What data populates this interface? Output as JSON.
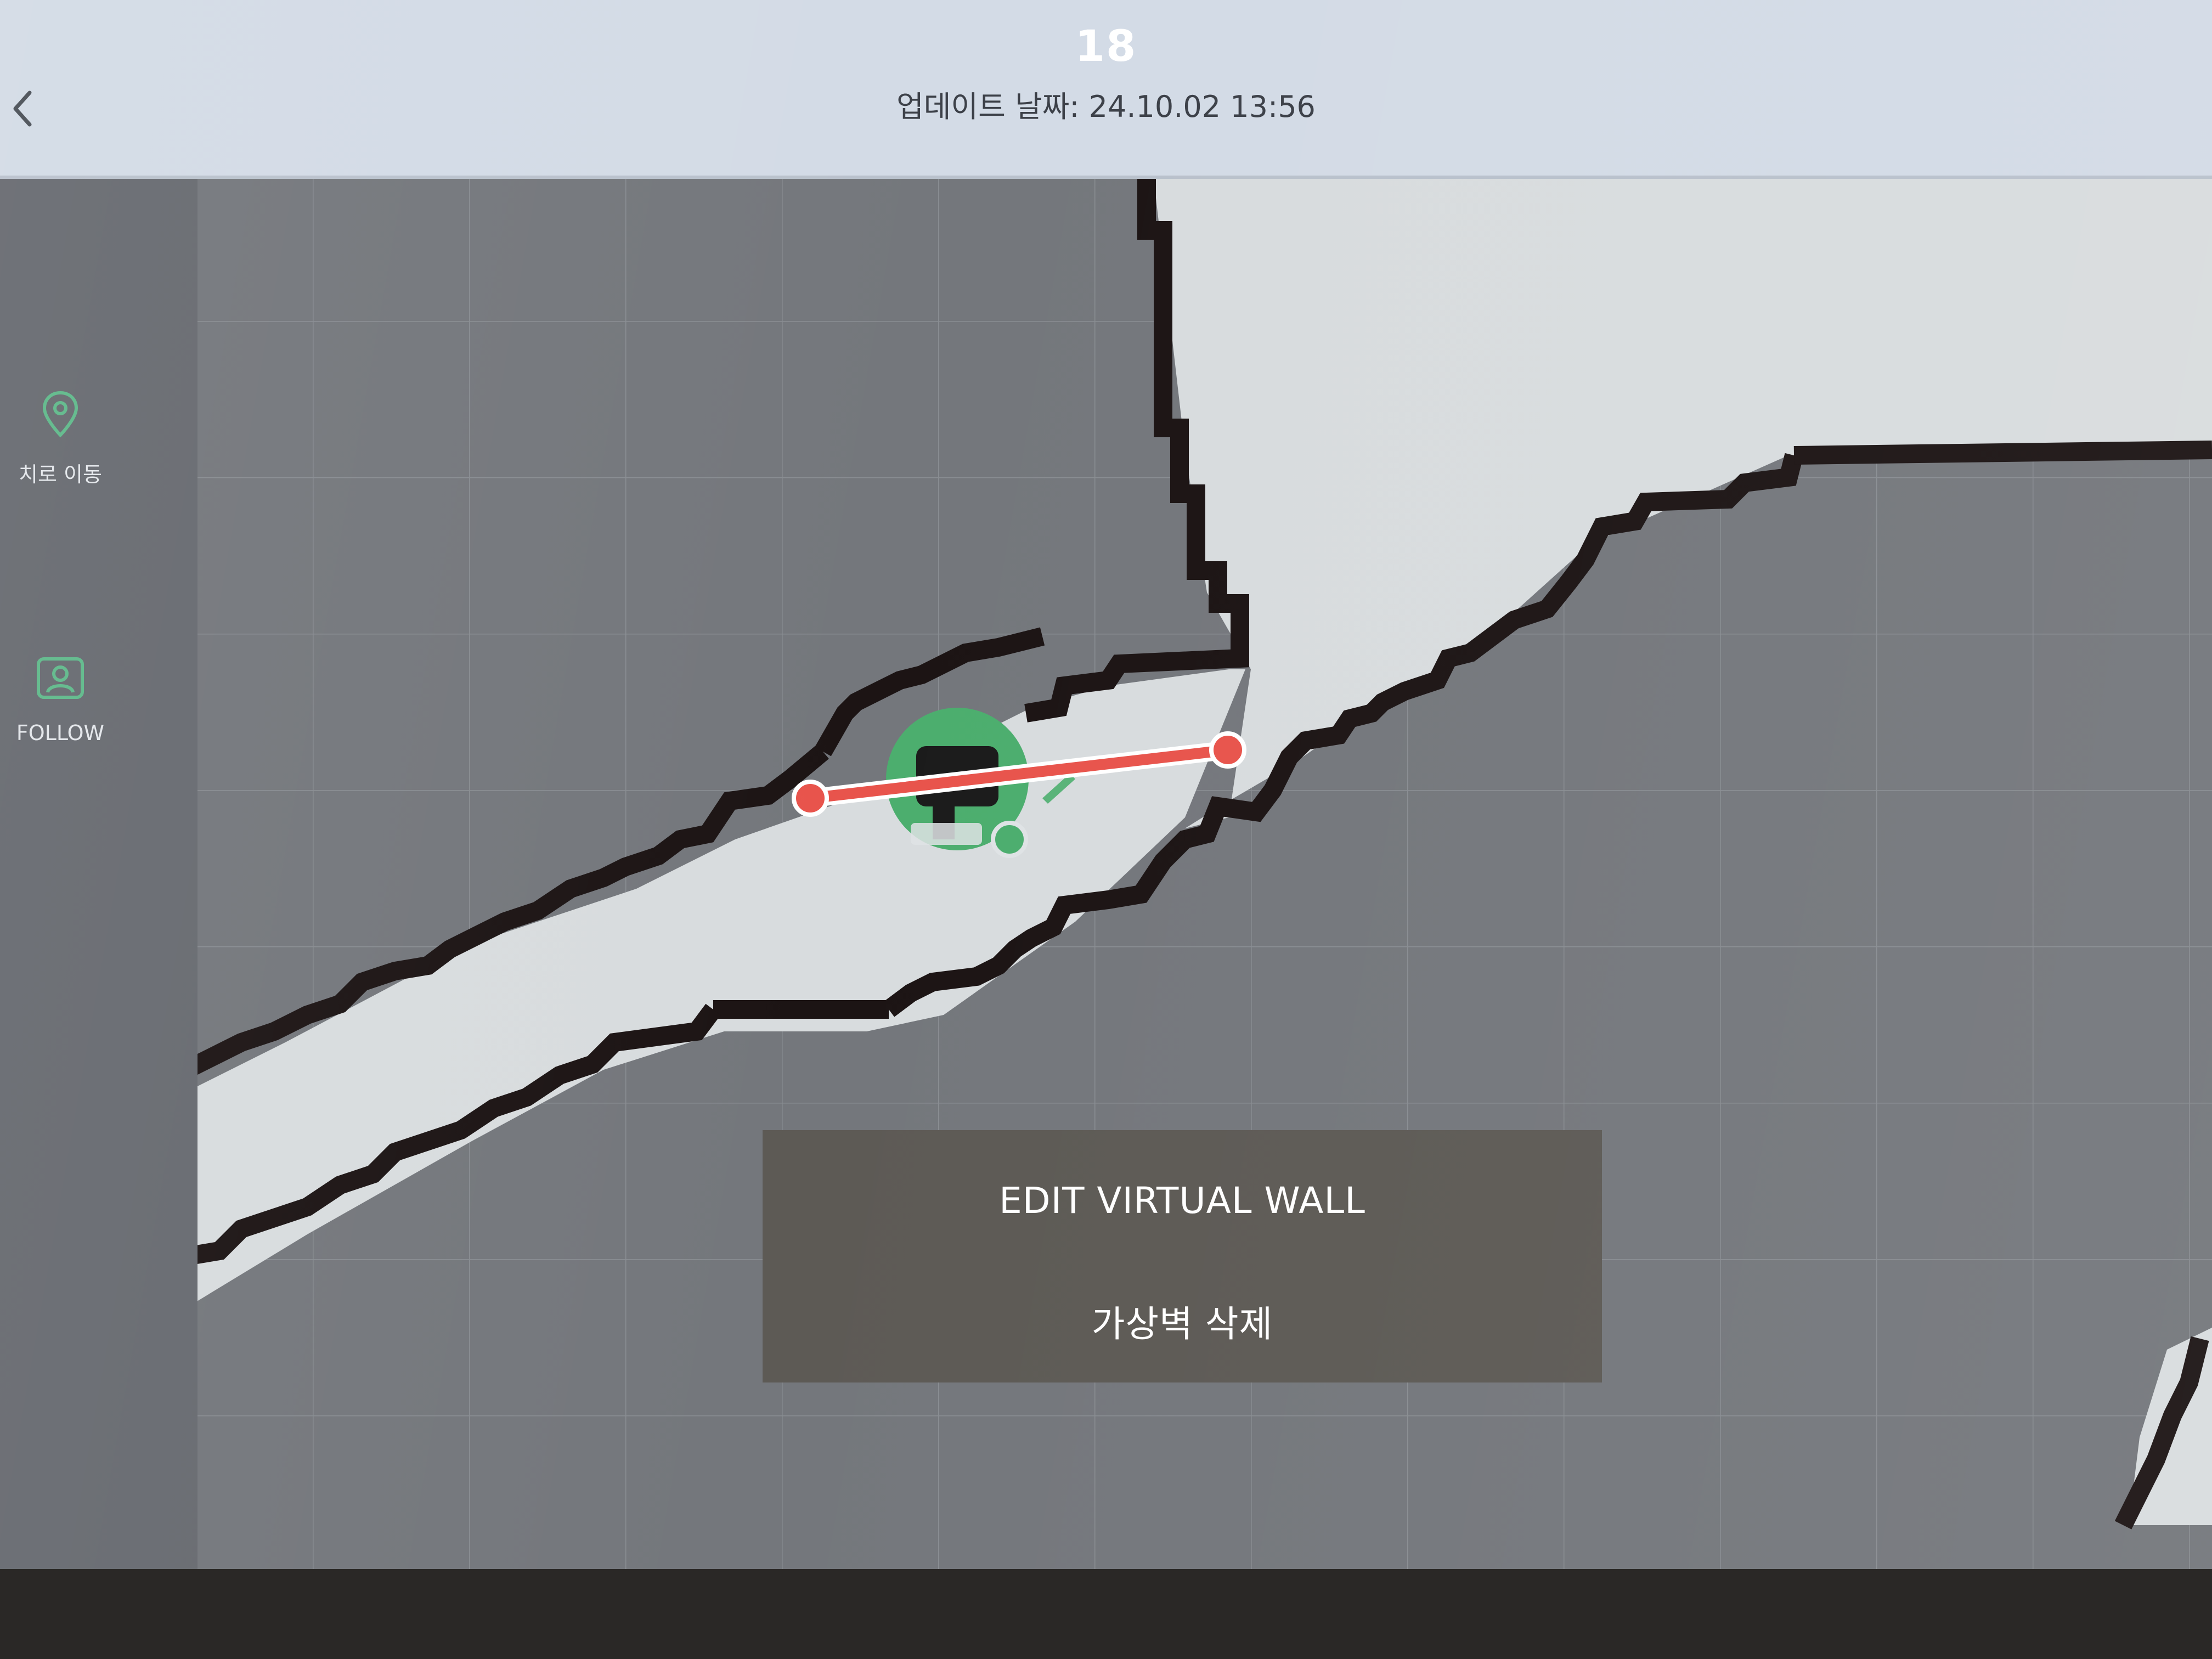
{
  "header": {
    "title": "18",
    "updated": "업데이트 날짜: 24.10.02 13:56"
  },
  "sidebar": {
    "move_label": "치로 이동",
    "follow_label": "FOLLOW"
  },
  "dialog": {
    "edit_label": "EDIT VIRTUAL WALL",
    "delete_label": "가상벽 삭제"
  },
  "icons": {
    "back": "chevron-left-icon",
    "location": "location-pin-icon",
    "follow": "person-icon",
    "robot": "robot-icon"
  },
  "colors": {
    "virtual_wall": "#e8544c",
    "robot": "#4cae6e",
    "free_space": "#d8dcde",
    "obstacle": "#1c1414",
    "unknown": "#74777c",
    "dialog_bg": "#5d5a55"
  }
}
